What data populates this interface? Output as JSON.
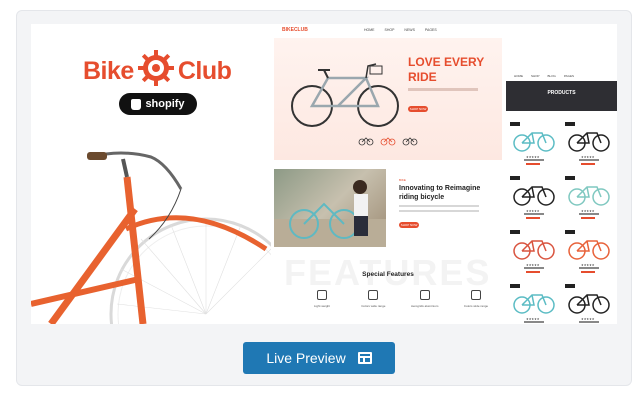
{
  "card": {
    "logo": {
      "word1": "Bike",
      "word2": "Club"
    },
    "badge": {
      "label": "shopify",
      "icon": "shopping-bag-icon"
    },
    "mock_site": {
      "brand": "BIKECLUB",
      "nav": [
        "HOME",
        "SHOP",
        "NEWS",
        "PAGES"
      ],
      "hero_title": "LOVE EVERY RIDE",
      "hero_button": "SHOP NOW",
      "section_tag": "BIKE",
      "section_title": "Innovating to Reimagine riding bicycle",
      "section_button": "SHOP NOW",
      "features_watermark": "FEATURES",
      "features_title": "Special Features",
      "features": [
        "Light weight",
        "Colors wide range",
        "Aerogrids aluminium",
        "Colors wide range"
      ]
    },
    "mock_shop": {
      "nav": [
        "HOME",
        "SHOP",
        "BLOG",
        "PAGES"
      ],
      "banner_title": "PRODUCTS",
      "products": [
        {
          "color": "#5bbcc4"
        },
        {
          "color": "#222222"
        },
        {
          "color": "#222222"
        },
        {
          "color": "#7fc8c0"
        },
        {
          "color": "#d9543f"
        },
        {
          "color": "#e8623a"
        },
        {
          "color": "#5bbcc4"
        },
        {
          "color": "#222222"
        }
      ]
    },
    "button": {
      "label": "Live Preview",
      "icon": "preview-layout-icon"
    }
  },
  "colors": {
    "brand": "#e64d2e",
    "button": "#1f78b4",
    "badge": "#111111"
  }
}
